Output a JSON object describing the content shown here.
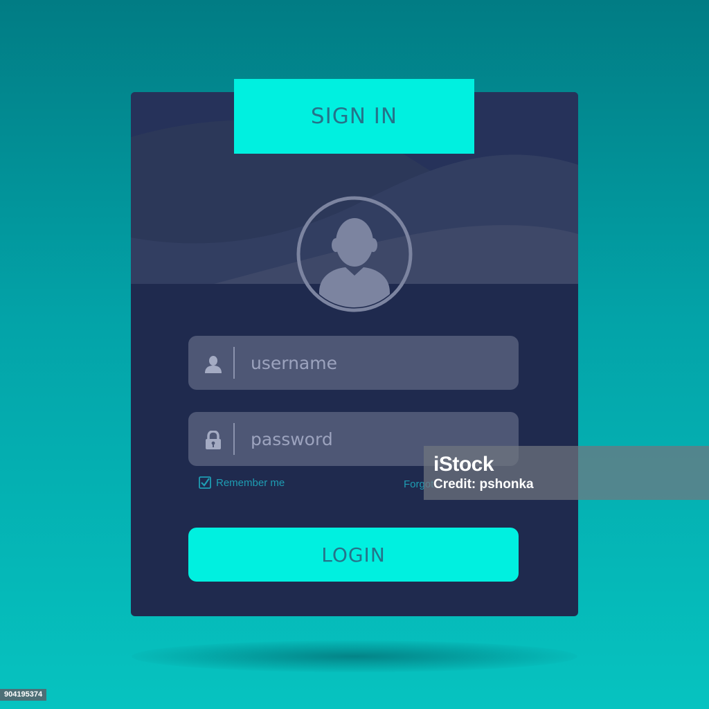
{
  "colors": {
    "background_top": "#017c84",
    "background_bottom": "#06c3c0",
    "card": "#1f2a4e",
    "accent": "#00f0e0",
    "accent_text": "#25738a",
    "field": "#4e5775",
    "field_text": "#9ca3be",
    "link": "#1e9db3"
  },
  "header": {
    "title": "SIGN IN"
  },
  "avatar": {
    "icon": "user-avatar-icon"
  },
  "form": {
    "username": {
      "icon": "user-icon",
      "placeholder": "username",
      "value": ""
    },
    "password": {
      "icon": "lock-icon",
      "placeholder": "password",
      "value": ""
    },
    "remember": {
      "label": "Remember me",
      "checked": true,
      "icon": "checkbox-checked-icon"
    },
    "forgot_label": "Forgot",
    "login_label": "LOGIN"
  },
  "watermark": {
    "logo": "iStock",
    "credit": "Credit: pshonka",
    "image_id": "904195374"
  }
}
